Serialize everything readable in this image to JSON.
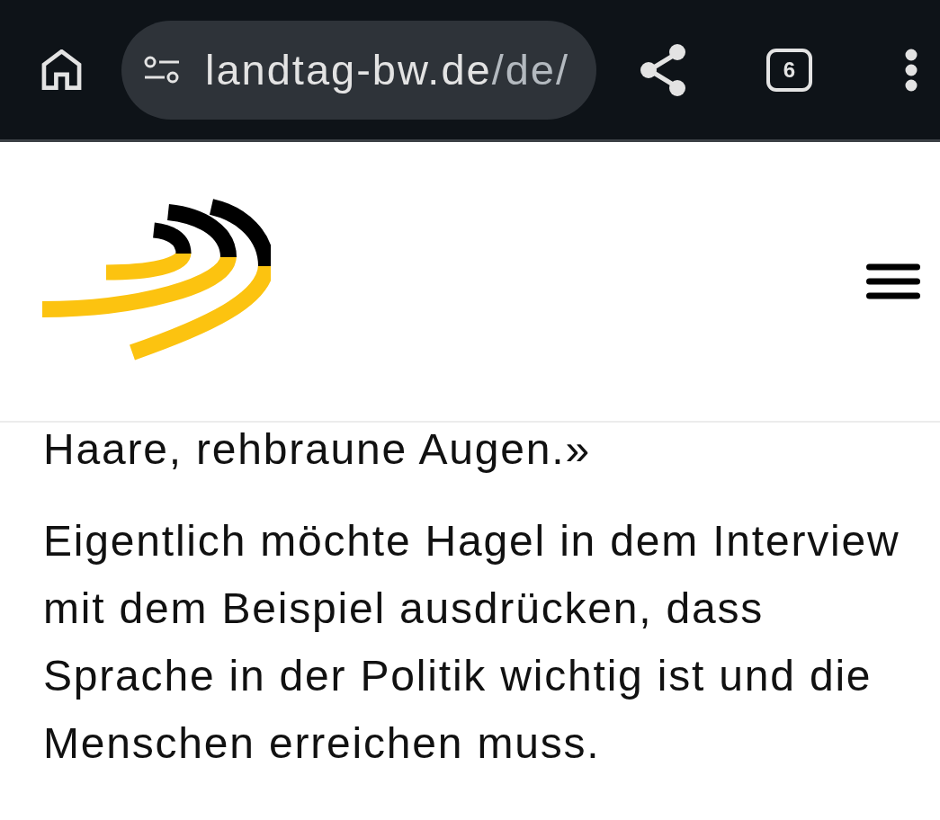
{
  "browser_toolbar": {
    "url": {
      "domain": "landtag-bw.de",
      "path": "/de/"
    },
    "tab_count": "6"
  },
  "article": {
    "paragraphs": [
      "Haare, rehbraune Augen.»",
      "Eigentlich möchte Hagel in dem Interview mit dem Beispiel ausdrücken, dass Sprache in der Politik wichtig ist und die Menschen erreichen muss."
    ]
  }
}
